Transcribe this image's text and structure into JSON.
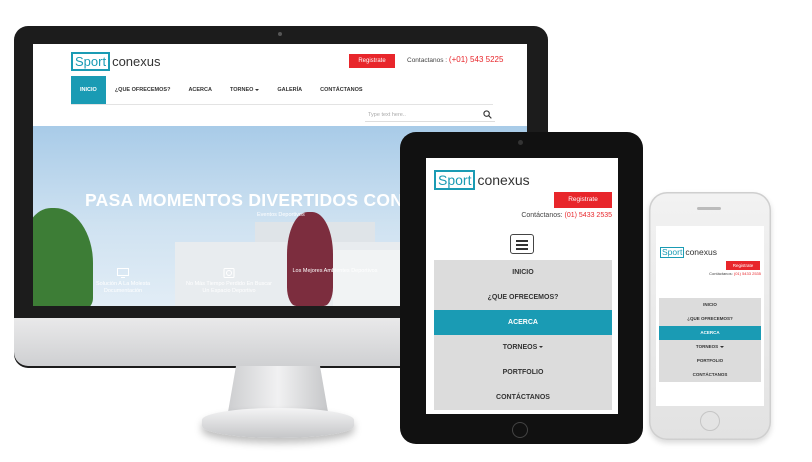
{
  "brand": {
    "logo_part1": "Sport",
    "logo_part2": "conexus",
    "accent": "#1a9bb4",
    "red": "#e8262b"
  },
  "desktop": {
    "register_label": "Registrate",
    "contact_label": "Contactanos :",
    "phone": "(+01) 543 5225",
    "nav": [
      {
        "label": "INICIO",
        "active": true
      },
      {
        "label": "¿QUE OFRECEMOS?"
      },
      {
        "label": "ACERCA"
      },
      {
        "label": "TORNEO"
      },
      {
        "label": "GALERÍA"
      },
      {
        "label": "CONTÁCTANOS"
      }
    ],
    "search_placeholder": "Type text here..",
    "hero_title": "PASA MOMENTOS DIVERTIDOS CON",
    "hero_subtitle": "Eventos Deportivos",
    "features": [
      {
        "icon": "monitor-icon",
        "line1": "Solución A La Molesta",
        "line2": "Documentación"
      },
      {
        "icon": "timer-icon",
        "line1": "No Más Tiempo Perdido En Buscar",
        "line2": "Un Espacio Deportivo"
      },
      {
        "icon": "star-icon",
        "line1": "Los Mejores Ambientes Deportivos",
        "line2": ""
      }
    ]
  },
  "tablet": {
    "register_label": "Registrate",
    "contact_label": "Contáctanos:",
    "phone": "(01) 5433 2535",
    "menu": [
      {
        "label": "INICIO"
      },
      {
        "label": "¿QUE OFRECEMOS?"
      },
      {
        "label": "ACERCA",
        "active": true
      },
      {
        "label": "TORNEOS"
      },
      {
        "label": "PORTFOLIO"
      },
      {
        "label": "CONTÁCTANOS"
      }
    ]
  },
  "phone_device": {
    "register_label": "Registrate",
    "contact_label": "Contáctanos:",
    "phone": "(01) 5433 2535",
    "menu": [
      {
        "label": "INICIO"
      },
      {
        "label": "¿QUE OFRECEMOS?"
      },
      {
        "label": "ACERCA",
        "active": true
      },
      {
        "label": "TORNEOS"
      },
      {
        "label": "PORTFOLIO"
      },
      {
        "label": "CONTÁCTANOS"
      }
    ]
  }
}
